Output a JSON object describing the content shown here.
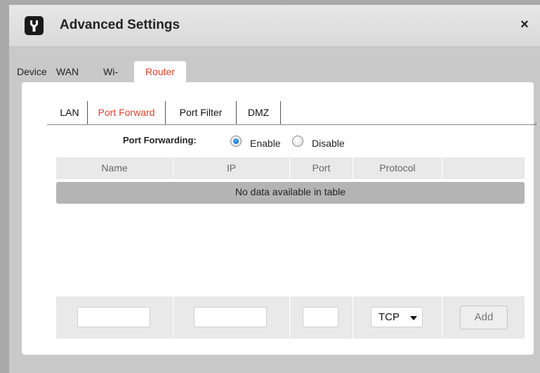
{
  "dialog": {
    "title": "Advanced Settings",
    "close_label": "×",
    "title_icon": "wrench-icon"
  },
  "top_tabs": [
    {
      "label": "Device",
      "active": false
    },
    {
      "label": "WAN",
      "active": false
    },
    {
      "label": "Wi-Fi",
      "active": false
    },
    {
      "label": "Router",
      "active": true
    }
  ],
  "sub_tabs": [
    {
      "label": "LAN",
      "active": false
    },
    {
      "label": "Port Forward",
      "active": true
    },
    {
      "label": "Port Filter",
      "active": false
    },
    {
      "label": "DMZ",
      "active": false
    }
  ],
  "port_forwarding": {
    "label": "Port Forwarding:",
    "options": [
      {
        "label": "Enable",
        "checked": true
      },
      {
        "label": "Disable",
        "checked": false
      }
    ]
  },
  "table": {
    "columns": [
      "Name",
      "IP",
      "Port",
      "Protocol",
      ""
    ],
    "empty_message": "No data available in table"
  },
  "form": {
    "name_value": "",
    "ip_value": "",
    "port_value": "",
    "protocol_selected": "TCP",
    "add_label": "Add"
  },
  "colors": {
    "accent": "#e8402a",
    "radio_checked": "#1a6fd0"
  }
}
